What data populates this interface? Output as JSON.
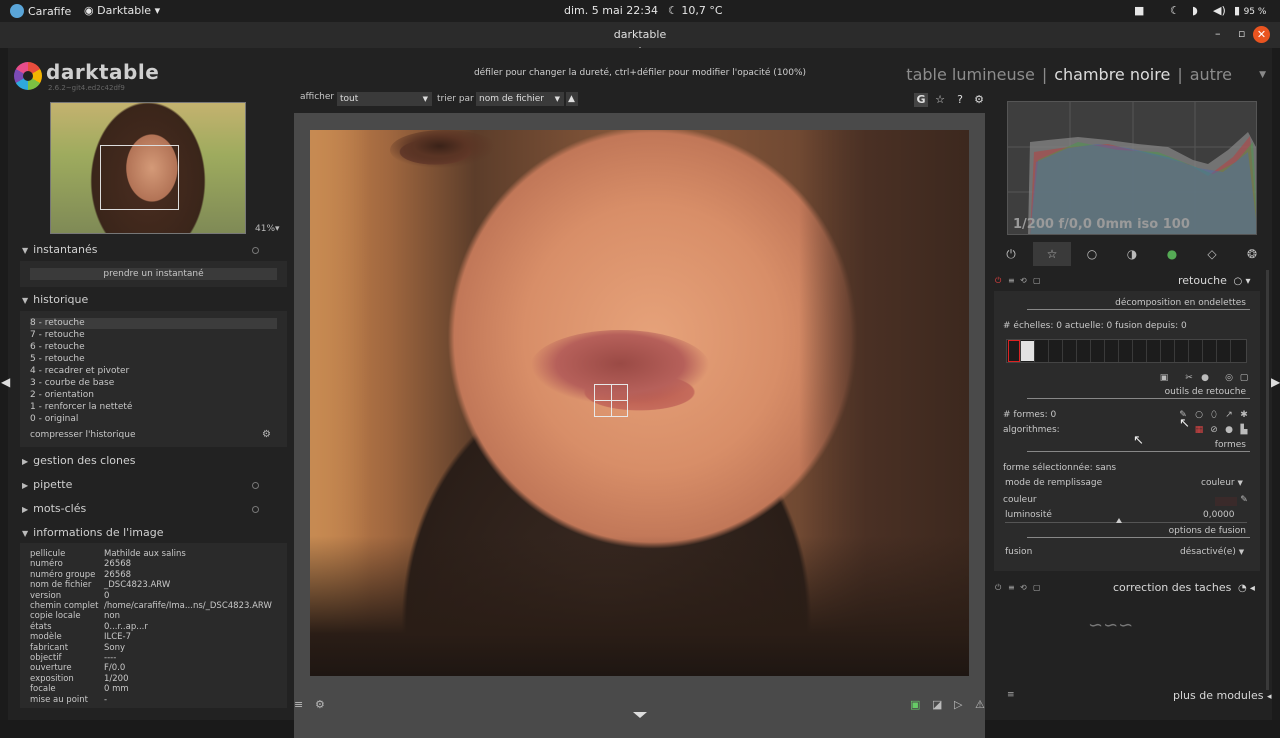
{
  "os_bar": {
    "app_name": "Carafife",
    "active_app": "Darktable",
    "datetime": "dim. 5 mai  22:34",
    "weather": "10,7 °C",
    "battery": "95 %"
  },
  "window": {
    "title": "darktable",
    "minimize": "–",
    "maximize": "▫",
    "close": "✕"
  },
  "header": {
    "brand": "darktable",
    "version": "2.6.2~git4.ed2c42df9",
    "hint": "défiler pour changer la dureté, ctrl+défiler pour modifier l'opacité (100%)",
    "views": [
      "table lumineuse",
      "chambre noire",
      "autre"
    ],
    "active_view": "chambre noire"
  },
  "left": {
    "zoom": "41%",
    "snapshots_title": "instantanés",
    "snapshot_button": "prendre un instantané",
    "history_title": "historique",
    "history": [
      "8 - retouche",
      "7 - retouche",
      "6 - retouche",
      "5 - retouche",
      "4 - recadrer et pivoter",
      "3 - courbe de base",
      "2 - orientation",
      "1 - renforcer la netteté",
      "0 - original"
    ],
    "compress": "compresser l'historique",
    "clones_title": "gestion des clones",
    "pipette_title": "pipette",
    "tags_title": "mots-clés",
    "info_title": "informations de l'image",
    "info": [
      [
        "pellicule",
        "Mathilde aux salins"
      ],
      [
        "numéro",
        "26568"
      ],
      [
        "numéro groupe",
        "26568"
      ],
      [
        "nom de fichier",
        "_DSC4823.ARW"
      ],
      [
        "version",
        "0"
      ],
      [
        "chemin complet",
        "/home/carafife/Ima...ns/_DSC4823.ARW"
      ],
      [
        "copie locale",
        "non"
      ],
      [
        "états",
        "0...r..ap...r"
      ],
      [
        "modèle",
        "ILCE-7"
      ],
      [
        "fabricant",
        "Sony"
      ],
      [
        "objectif",
        "----"
      ],
      [
        "ouverture",
        "F/0.0"
      ],
      [
        "exposition",
        "1/200"
      ],
      [
        "focale",
        "0 mm"
      ],
      [
        "mise au point",
        "-"
      ]
    ]
  },
  "center": {
    "show_label": "afficher",
    "show_value": "tout",
    "sort_label": "trier par",
    "sort_value": "nom de fichier"
  },
  "right": {
    "histogram_info": "1/200 f/0,0 0mm iso 100",
    "module_title": "retouche",
    "wavelet_section": "décomposition en ondelettes",
    "scales": "# échelles:  0   actuelle:  0   fusion depuis:  0",
    "tools_section": "outils de retouche",
    "shapes_count": "# formes:  0",
    "algorithms": "algorithmes:",
    "shapes_section": "formes",
    "selected_shape": "forme sélectionnée: sans",
    "fill_mode_label": "mode de remplissage",
    "fill_mode_value": "couleur",
    "color_label": "couleur",
    "brightness_label": "luminosité",
    "brightness_value": "0,0000",
    "brightness_level": 0.47,
    "fusion_section": "options de fusion",
    "fusion_label": "fusion",
    "fusion_value": "désactivé(e)",
    "spots_title": "correction des taches",
    "more_modules": "plus de modules"
  }
}
